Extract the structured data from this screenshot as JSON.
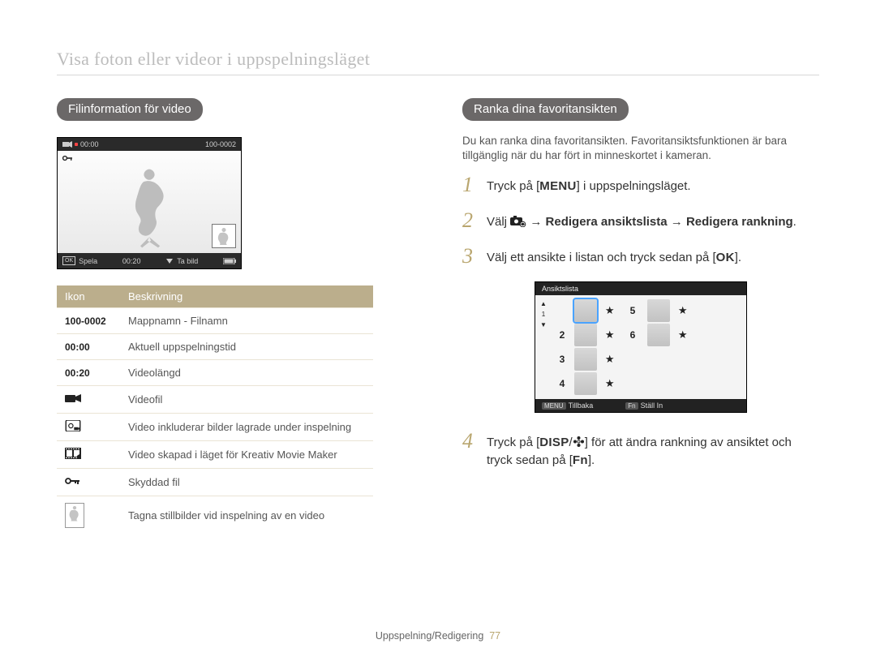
{
  "page_title": "Visa foton eller videor i uppspelningsläget",
  "left": {
    "pill": "Filinformation för video",
    "player": {
      "file_no": "100-0002",
      "time_cur": "00:00",
      "time_len": "00:20",
      "play_label": "Spela",
      "capture_label": "Ta bild",
      "ok_label": "OK"
    },
    "table": {
      "hdr_icon": "Ikon",
      "hdr_desc": "Beskrivning",
      "rows": [
        {
          "icon_text": "100-0002",
          "desc": "Mappnamn - Filnamn"
        },
        {
          "icon_text": "00:00",
          "desc": "Aktuell uppspelningstid"
        },
        {
          "icon_text": "00:20",
          "desc": "Videolängd"
        },
        {
          "icon_text": "videocam-icon",
          "desc": "Videofil"
        },
        {
          "icon_text": "photo-in-video-icon",
          "desc": "Video inkluderar bilder lagrade under inspelning"
        },
        {
          "icon_text": "filmstrip-icon",
          "desc": "Video skapad i läget för Kreativ Movie Maker"
        },
        {
          "icon_text": "key-icon",
          "desc": "Skyddad fil"
        },
        {
          "icon_text": "skater-thumb-icon",
          "desc": "Tagna stillbilder vid inspelning av en video"
        }
      ]
    }
  },
  "right": {
    "pill": "Ranka dina favoritansikten",
    "intro": "Du kan ranka dina favoritansikten. Favoritansiktsfunktionen är bara tillgänglig när du har fört in minneskortet i kameran.",
    "steps": {
      "s1_a": "Tryck på [",
      "s1_menu": "MENU",
      "s1_b": "] i uppspelningsläget.",
      "s2_a": "Välj ",
      "s2_b": " → ",
      "s2_bold1": "Redigera ansiktslista",
      "s2_c": " → ",
      "s2_bold2": "Redigera rankning",
      "s2_d": ".",
      "s3_a": "Välj ett ansikte i listan och tryck sedan på [",
      "s3_ok": "OK",
      "s3_b": "].",
      "s4_a": "Tryck på [",
      "s4_disp": "DISP",
      "s4_b": "/",
      "s4_flower": "✿",
      "s4_c": "] för att ändra rankning av ansiktet och tryck sedan på [",
      "s4_fn": "Fn",
      "s4_d": "]."
    },
    "facepanel": {
      "title": "Ansiktslista",
      "back_label": "Tillbaka",
      "set_label": "Ställ In",
      "back_btn": "MENU",
      "set_btn": "Fn",
      "nums": {
        "n1": "1",
        "n2": "2",
        "n3": "3",
        "n4": "4",
        "n5": "5",
        "n6": "6"
      },
      "star": "★"
    }
  },
  "footer": {
    "section": "Uppspelning/Redigering",
    "page": "77"
  }
}
